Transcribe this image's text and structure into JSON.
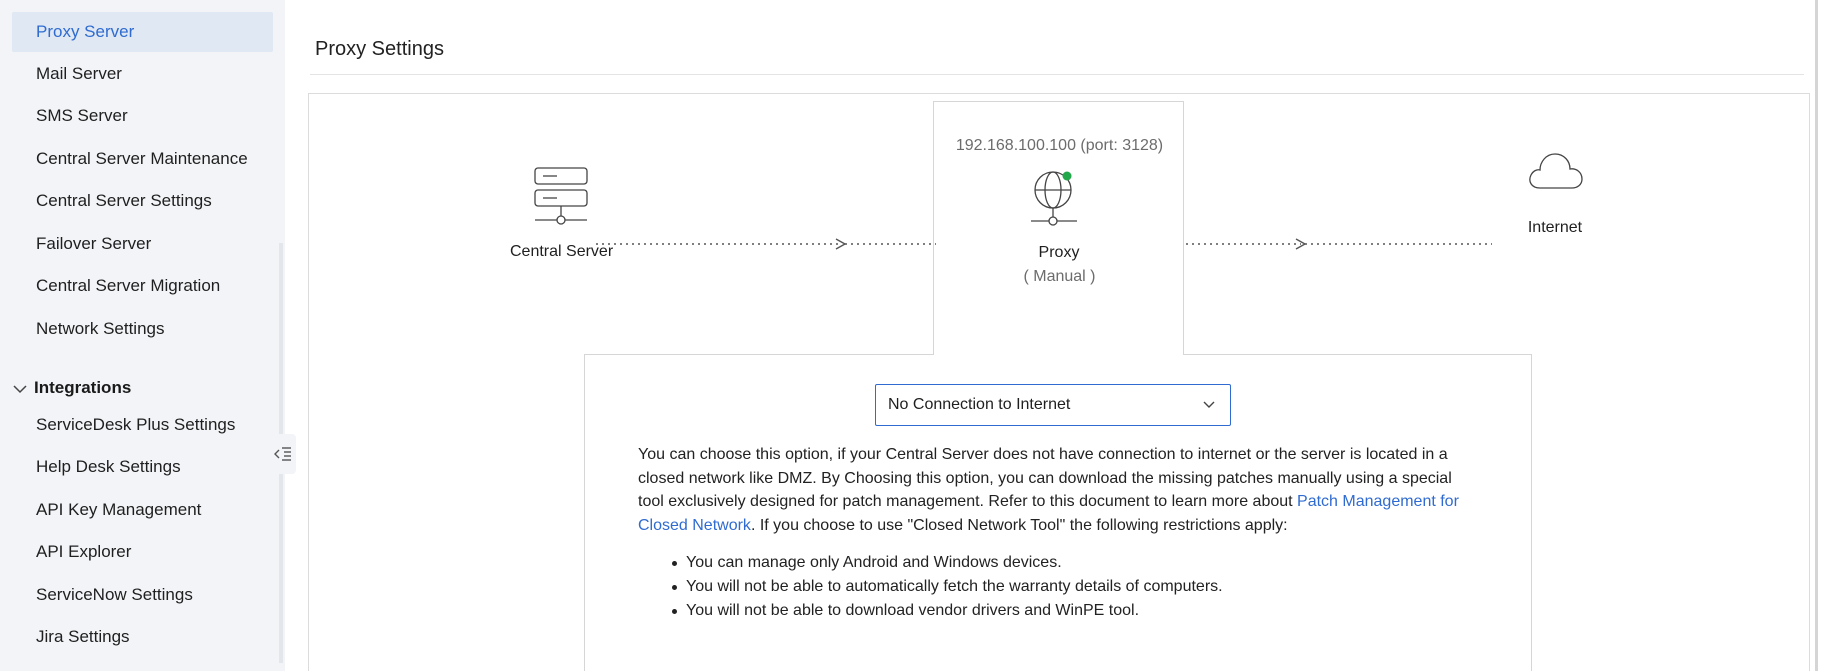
{
  "sidebar": {
    "items": [
      {
        "label": "Proxy Server",
        "active": true
      },
      {
        "label": "Mail Server"
      },
      {
        "label": "SMS Server"
      },
      {
        "label": "Central Server Maintenance"
      },
      {
        "label": "Central Server Settings"
      },
      {
        "label": "Failover Server"
      },
      {
        "label": "Central Server Migration"
      },
      {
        "label": "Network Settings"
      }
    ],
    "section": {
      "label": "Integrations",
      "items": [
        {
          "label": "ServiceDesk Plus Settings"
        },
        {
          "label": "Help Desk Settings"
        },
        {
          "label": "API Key Management"
        },
        {
          "label": "API Explorer"
        },
        {
          "label": "ServiceNow Settings"
        },
        {
          "label": "Jira Settings"
        }
      ]
    },
    "collapse_icon": "sidebar-collapse-icon"
  },
  "page": {
    "title": "Proxy Settings"
  },
  "diagram": {
    "central_server_label": "Central Server",
    "proxy_ip": "192.168.100.100 (port: 3128)",
    "proxy_label": "Proxy",
    "proxy_mode": "( Manual )",
    "internet_label": "Internet",
    "status_color": "#22a84a"
  },
  "connection": {
    "selected": "No Connection to Internet",
    "description_part1": "You can choose this option, if your Central Server does not have connection to internet or the server is located in a closed network like DMZ. By Choosing this option, you can download the missing patches manually using a special tool exclusively designed for patch management. Refer to this document to learn more about ",
    "description_link": "Patch Management for Closed Network",
    "description_part2": ". If you choose to use \"Closed Network Tool\" the following restrictions apply:",
    "restrictions": [
      "You can manage only Android and Windows devices.",
      "You will not be able to automatically fetch the warranty details of computers.",
      "You will not be able to download vendor drivers and WinPE tool."
    ]
  },
  "colors": {
    "accent": "#2f6bd0",
    "sidebar_bg": "#f2f4f7",
    "active_bg": "#dfe8f3"
  }
}
